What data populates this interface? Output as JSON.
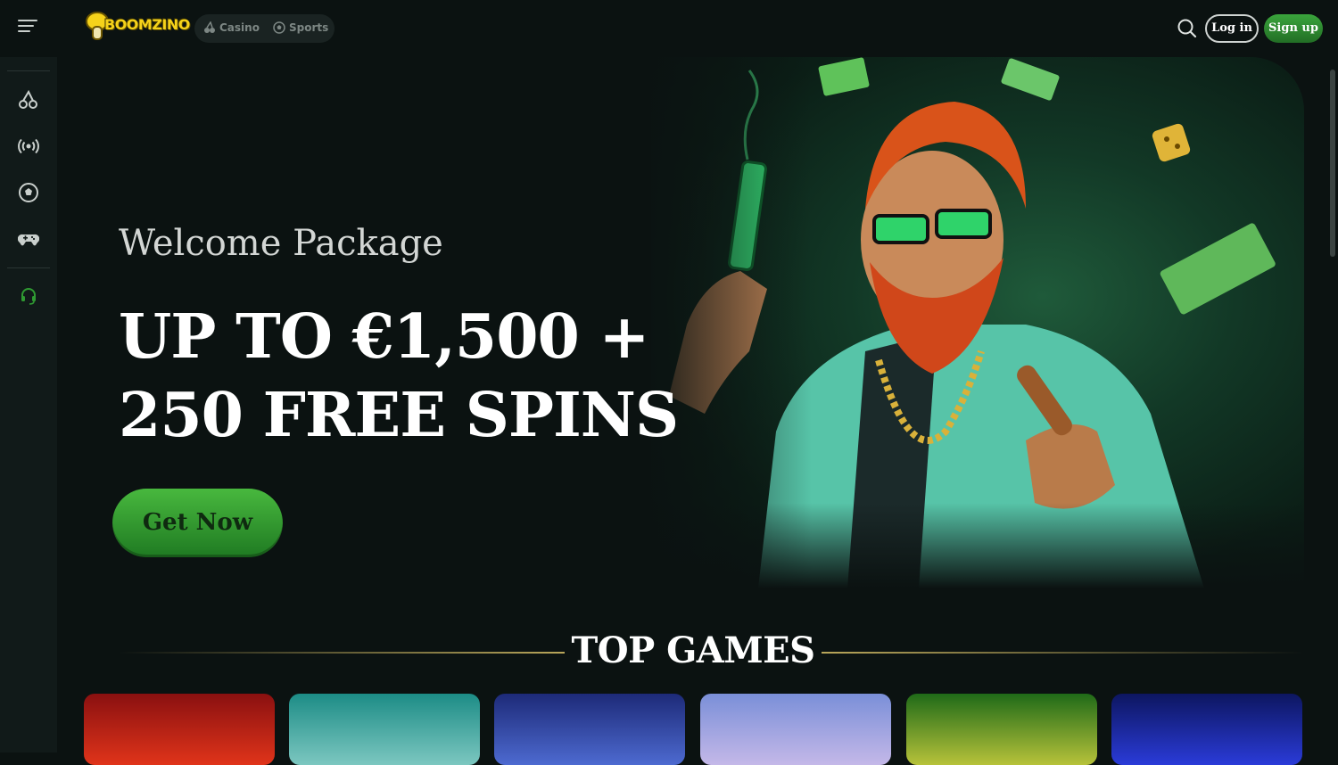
{
  "brand": {
    "name": "BOOMZINO"
  },
  "nav": {
    "modes": [
      {
        "label": "Casino",
        "icon": "cherries-icon"
      },
      {
        "label": "Sports",
        "icon": "soccer-ball-icon"
      }
    ]
  },
  "auth": {
    "login_label": "Log in",
    "signup_label": "Sign up"
  },
  "sidebar": {
    "items": [
      {
        "icon": "cherries-icon"
      },
      {
        "icon": "live-broadcast-icon"
      },
      {
        "icon": "soccer-ball-icon"
      },
      {
        "icon": "gamepad-icon"
      },
      {
        "icon": "headset-support-icon"
      }
    ]
  },
  "hero": {
    "subtitle": "Welcome Package",
    "headline_line1": "UP TO €1,500 +",
    "headline_line2": "250 FREE SPINS",
    "cta_label": "Get Now"
  },
  "top_games": {
    "title": "TOP GAMES",
    "tiles": [
      {
        "color_top": "#8a1010",
        "color_bottom": "#e0341a"
      },
      {
        "color_top": "#1c8c86",
        "color_bottom": "#7cc7c0"
      },
      {
        "color_top": "#1d2a78",
        "color_bottom": "#4d6ad0"
      },
      {
        "color_top": "#7a8fd8",
        "color_bottom": "#c4b8e8"
      },
      {
        "color_top": "#1f6a18",
        "color_bottom": "#b7c23a"
      },
      {
        "color_top": "#0d1660",
        "color_bottom": "#2a3bd8"
      }
    ]
  },
  "colors": {
    "accent_green": "#2f9a32",
    "background": "#0b1211",
    "sidebar": "#111a19"
  }
}
